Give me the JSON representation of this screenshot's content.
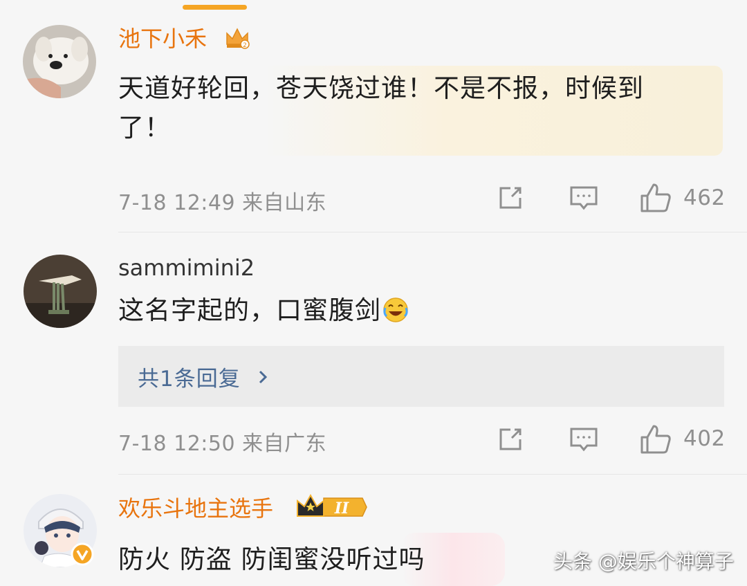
{
  "comments": [
    {
      "username": "池下小禾",
      "content": "天道好轮回，苍天饶过谁！不是不报，时候到了！",
      "meta": "7-18 12:49 来自山东",
      "likes": "462",
      "badge_icon": "crown-level-2-icon"
    },
    {
      "username": "sammimini2",
      "content": "这名字起的，口蜜腹剑",
      "emoji": "laugh-cry-emoji-icon",
      "reply_label": "共1条回复",
      "meta": "7-18 12:50 来自广东",
      "likes": "402"
    },
    {
      "username": "欢乐斗地主选手",
      "content": "防火 防盗 防闺蜜没听过吗",
      "badge_icon": "vip-crown-II-icon",
      "badge_text": "II"
    }
  ],
  "watermark": "头条 @娱乐个神算子",
  "colors": {
    "vip_name": "#e8740e",
    "meta_gray": "#8f8f8f",
    "reply_link": "#4a6a94",
    "accent": "#f5a524"
  }
}
